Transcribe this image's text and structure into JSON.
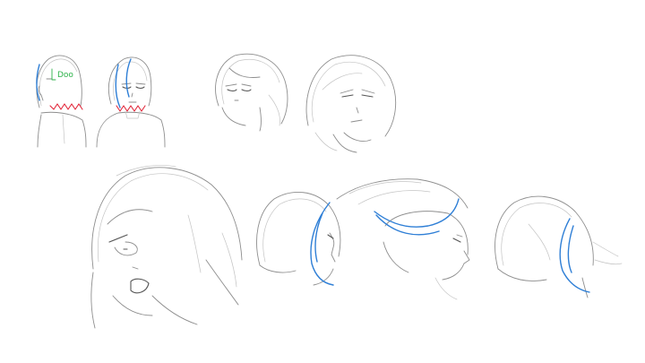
{
  "canvas": {
    "background": "#ffffff"
  },
  "colors": {
    "pencil": "#8e8e8e",
    "pencil_light": "#c4c4c4",
    "accent_blue": "#2f7fd6",
    "accent_red": "#e2273a",
    "accent_green": "#2db34a"
  },
  "annotation": {
    "text": "Doo"
  }
}
